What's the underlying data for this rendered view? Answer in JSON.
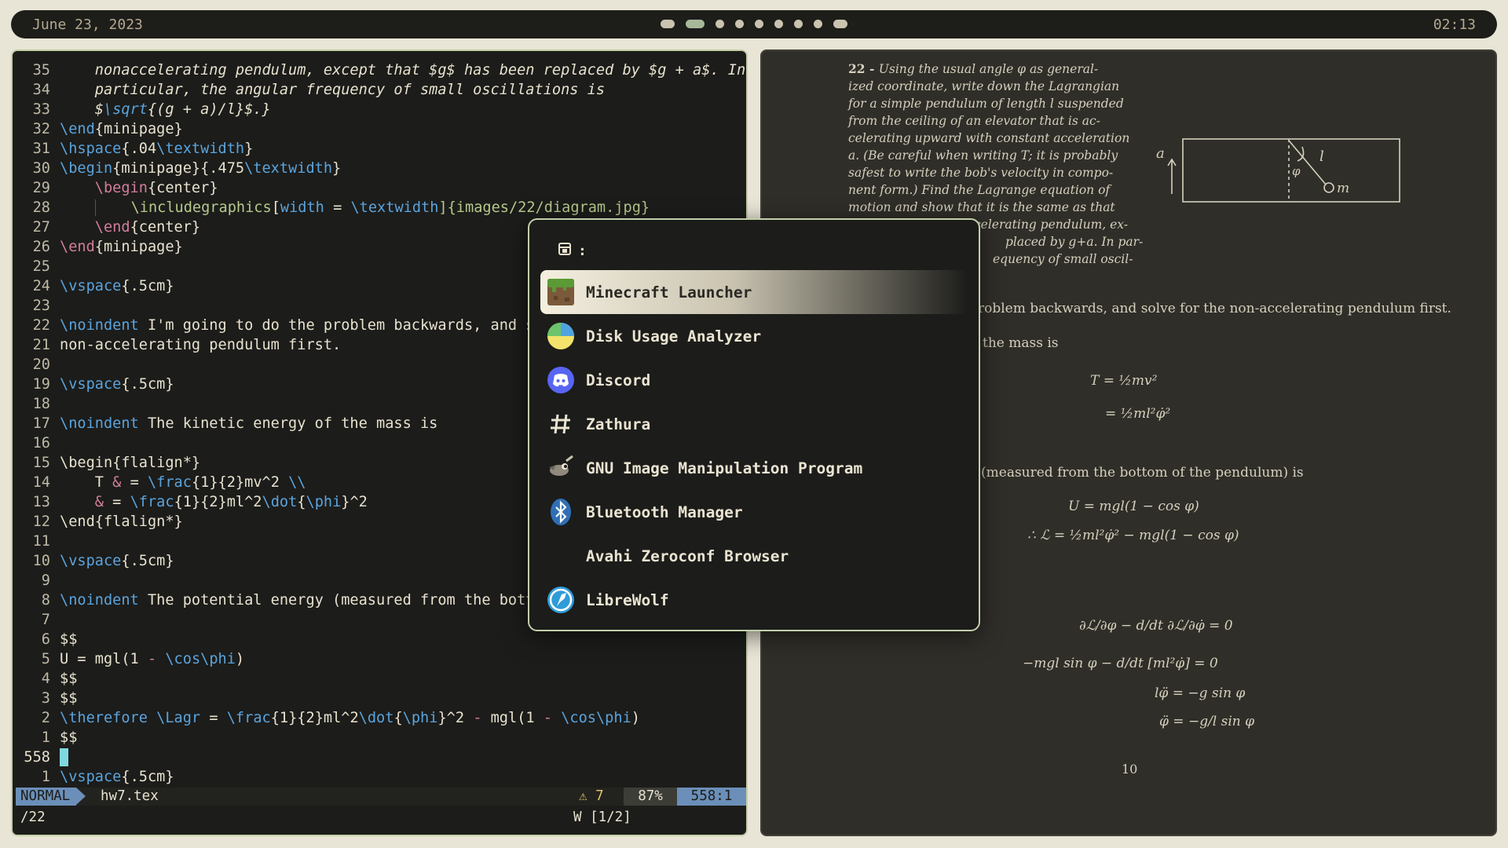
{
  "topbar": {
    "date": "June 23, 2023",
    "time": "02:13",
    "workspaces": 9,
    "active_workspace": 2
  },
  "editor": {
    "lines": [
      {
        "n": "35",
        "segs": [
          [
            "    ",
            ""
          ],
          [
            "nonaccelerating pendulum, except that $g$ has been replaced by $g + a$. In",
            "it"
          ]
        ]
      },
      {
        "n": "34",
        "segs": [
          [
            "    ",
            ""
          ],
          [
            "particular, the angular frequency of small oscillations is",
            "it"
          ]
        ]
      },
      {
        "n": "33",
        "segs": [
          [
            "    ",
            ""
          ],
          [
            "$",
            "it"
          ],
          [
            "\\sqrt",
            "cmd it"
          ],
          [
            "{(g + a)/l}$.}",
            "it"
          ]
        ]
      },
      {
        "n": "32",
        "segs": [
          [
            "\\end",
            "cmd"
          ],
          [
            "{minipage}",
            ""
          ]
        ]
      },
      {
        "n": "31",
        "segs": [
          [
            "\\hspace",
            "cmd"
          ],
          [
            "{.04",
            ""
          ],
          [
            "\\textwidth",
            "cmd"
          ],
          [
            "}",
            ""
          ]
        ]
      },
      {
        "n": "30",
        "segs": [
          [
            "\\begin",
            "cmd"
          ],
          [
            "{minipage}{.475",
            ""
          ],
          [
            "\\textwidth",
            "cmd"
          ],
          [
            "}",
            ""
          ]
        ]
      },
      {
        "n": "29",
        "segs": [
          [
            "    ",
            ""
          ],
          [
            "\\begin",
            "pink"
          ],
          [
            "{center}",
            ""
          ]
        ]
      },
      {
        "n": "28",
        "segs": [
          [
            "    ",
            ""
          ],
          [
            "  ",
            "guide"
          ],
          [
            "  ",
            ""
          ],
          [
            "\\includegraphics",
            "grn"
          ],
          [
            "[",
            ""
          ],
          [
            "width",
            "cmd"
          ],
          [
            " = ",
            ""
          ],
          [
            "\\textwidth",
            "cmd"
          ],
          [
            "]{images/22/diagram.jpg}",
            "grn"
          ]
        ]
      },
      {
        "n": "27",
        "segs": [
          [
            "    ",
            ""
          ],
          [
            "\\end",
            "pink"
          ],
          [
            "{center}",
            ""
          ]
        ]
      },
      {
        "n": "26",
        "segs": [
          [
            "\\end",
            "pink"
          ],
          [
            "{minipage}",
            ""
          ]
        ]
      },
      {
        "n": "25",
        "segs": []
      },
      {
        "n": "24",
        "segs": [
          [
            "\\vspace",
            "cmd"
          ],
          [
            "{.5cm}",
            ""
          ]
        ]
      },
      {
        "n": "23",
        "segs": []
      },
      {
        "n": "22",
        "segs": [
          [
            "\\noindent",
            "cmd"
          ],
          [
            " I'm going to do the problem backwards, and s",
            ""
          ]
        ]
      },
      {
        "n": "21",
        "segs": [
          [
            "non-accelerating pendulum first.",
            ""
          ]
        ]
      },
      {
        "n": "20",
        "segs": []
      },
      {
        "n": "19",
        "segs": [
          [
            "\\vspace",
            "cmd"
          ],
          [
            "{.5cm}",
            ""
          ]
        ]
      },
      {
        "n": "18",
        "segs": []
      },
      {
        "n": "17",
        "segs": [
          [
            "\\noindent",
            "cmd"
          ],
          [
            " The kinetic energy of the mass is",
            ""
          ]
        ]
      },
      {
        "n": "16",
        "segs": []
      },
      {
        "n": "15",
        "segs": [
          [
            "\\begin",
            ""
          ],
          [
            "{flalign*}",
            ""
          ]
        ]
      },
      {
        "n": "14",
        "segs": [
          [
            "    T ",
            ""
          ],
          [
            "&",
            "pink"
          ],
          [
            " = ",
            ""
          ],
          [
            "\\frac",
            "cmd"
          ],
          [
            "{1}{2}mv^2 ",
            ""
          ],
          [
            "\\\\",
            "cmd"
          ]
        ]
      },
      {
        "n": "13",
        "segs": [
          [
            "    ",
            ""
          ],
          [
            "&",
            "pink"
          ],
          [
            " = ",
            ""
          ],
          [
            "\\frac",
            "cmd"
          ],
          [
            "{1}{2}ml^2",
            ""
          ],
          [
            "\\dot",
            "cmd"
          ],
          [
            "{",
            ""
          ],
          [
            "\\phi",
            "cmd"
          ],
          [
            "}^2",
            ""
          ]
        ]
      },
      {
        "n": "12",
        "segs": [
          [
            "\\end",
            ""
          ],
          [
            "{flalign*}",
            ""
          ]
        ]
      },
      {
        "n": "11",
        "segs": []
      },
      {
        "n": "10",
        "segs": [
          [
            "\\vspace",
            "cmd"
          ],
          [
            "{.5cm}",
            ""
          ]
        ]
      },
      {
        "n": "9",
        "segs": []
      },
      {
        "n": "8",
        "segs": [
          [
            "\\noindent",
            "cmd"
          ],
          [
            " The potential energy (measured from the bott",
            ""
          ]
        ]
      },
      {
        "n": "7",
        "segs": []
      },
      {
        "n": "6",
        "segs": [
          [
            "$$",
            ""
          ]
        ]
      },
      {
        "n": "5",
        "segs": [
          [
            "U = mgl(1 ",
            ""
          ],
          [
            "-",
            "pink"
          ],
          [
            " ",
            ""
          ],
          [
            "\\cos\\phi",
            "cmd"
          ],
          [
            ")",
            ""
          ]
        ]
      },
      {
        "n": "4",
        "segs": [
          [
            "$$",
            ""
          ]
        ]
      },
      {
        "n": "3",
        "segs": [
          [
            "$$",
            ""
          ]
        ]
      },
      {
        "n": "2",
        "segs": [
          [
            "\\therefore",
            "cmd"
          ],
          [
            " ",
            ""
          ],
          [
            "\\Lagr",
            "cmd"
          ],
          [
            " = ",
            ""
          ],
          [
            "\\frac",
            "cmd"
          ],
          [
            "{1}{2}ml^2",
            ""
          ],
          [
            "\\dot",
            "cmd"
          ],
          [
            "{",
            ""
          ],
          [
            "\\phi",
            "cmd"
          ],
          [
            "}^2 ",
            ""
          ],
          [
            "-",
            "pink"
          ],
          [
            " mgl(1 ",
            ""
          ],
          [
            "-",
            "pink"
          ],
          [
            " ",
            ""
          ],
          [
            "\\cos\\phi",
            "cmd"
          ],
          [
            ")",
            ""
          ]
        ]
      },
      {
        "n": "1",
        "segs": [
          [
            "$$",
            ""
          ]
        ]
      },
      {
        "n": "558",
        "cursor": true,
        "segs": []
      },
      {
        "n": "1",
        "segs": [
          [
            "\\vspace",
            "cmd"
          ],
          [
            "{.5cm}",
            ""
          ]
        ]
      }
    ],
    "status": {
      "mode": "NORMAL",
      "file": "hw7.tex",
      "warnings": "⚠ 7",
      "percent": "87%",
      "position": "558:1"
    },
    "cmdline": {
      "search": "/22",
      "count": "W [1/2]"
    }
  },
  "launcher": {
    "prompt_icon": "window-icon",
    "prompt": ":",
    "entries": [
      {
        "label": "Minecraft Launcher",
        "icon": "minecraft-icon",
        "selected": true
      },
      {
        "label": "Disk Usage Analyzer",
        "icon": "disk-usage-icon"
      },
      {
        "label": "Discord",
        "icon": "discord-icon"
      },
      {
        "label": "Zathura",
        "icon": "hash-icon"
      },
      {
        "label": "GNU Image Manipulation Program",
        "icon": "gimp-icon"
      },
      {
        "label": "Bluetooth Manager",
        "icon": "bluetooth-icon"
      },
      {
        "label": "Avahi Zeroconf Browser",
        "icon": ""
      },
      {
        "label": "LibreWolf",
        "icon": "librewolf-icon"
      }
    ]
  },
  "pdf": {
    "problem_lines": [
      "Using the usual angle φ as general-",
      "ized coordinate, write down the Lagrangian",
      "for a simple pendulum of length l suspended",
      "from the ceiling of an elevator that is ac-",
      "celerating upward with constant acceleration",
      "a. (Be careful when writing T; it is probably",
      "safest to write the bob's velocity in compo-",
      "nent form.) Find the Lagrange equation of",
      "motion and show that it is the same as that",
      "celerating pendulum, ex-",
      "placed by g+a. In par-",
      "equency of small oscil-"
    ],
    "problem_number": "22 -",
    "diagram_labels": {
      "a": "a",
      "l": "l",
      "phi": "φ",
      "m": "m"
    },
    "text1": "roblem backwards, and solve for the non-accelerating pendulum first.",
    "text2": "the mass is",
    "eq_T1": "T = ½mv²",
    "eq_T2": "= ½ml²φ̇²",
    "text3": "(measured from the bottom of the pendulum) is",
    "eq_U": "U = mgl(1 − cos φ)",
    "eq_L": "∴ ℒ = ½ml²φ̇² − mgl(1 − cos φ)",
    "eq_EL": "∂ℒ/∂φ − d/dt ∂ℒ/∂φ̇ = 0",
    "eq_2": "−mgl sin φ − d/dt [ml²φ̇] = 0",
    "eq_3": "lφ̈ = −g sin φ",
    "eq_4": "φ̈ = −g/l sin φ",
    "page": "10"
  }
}
